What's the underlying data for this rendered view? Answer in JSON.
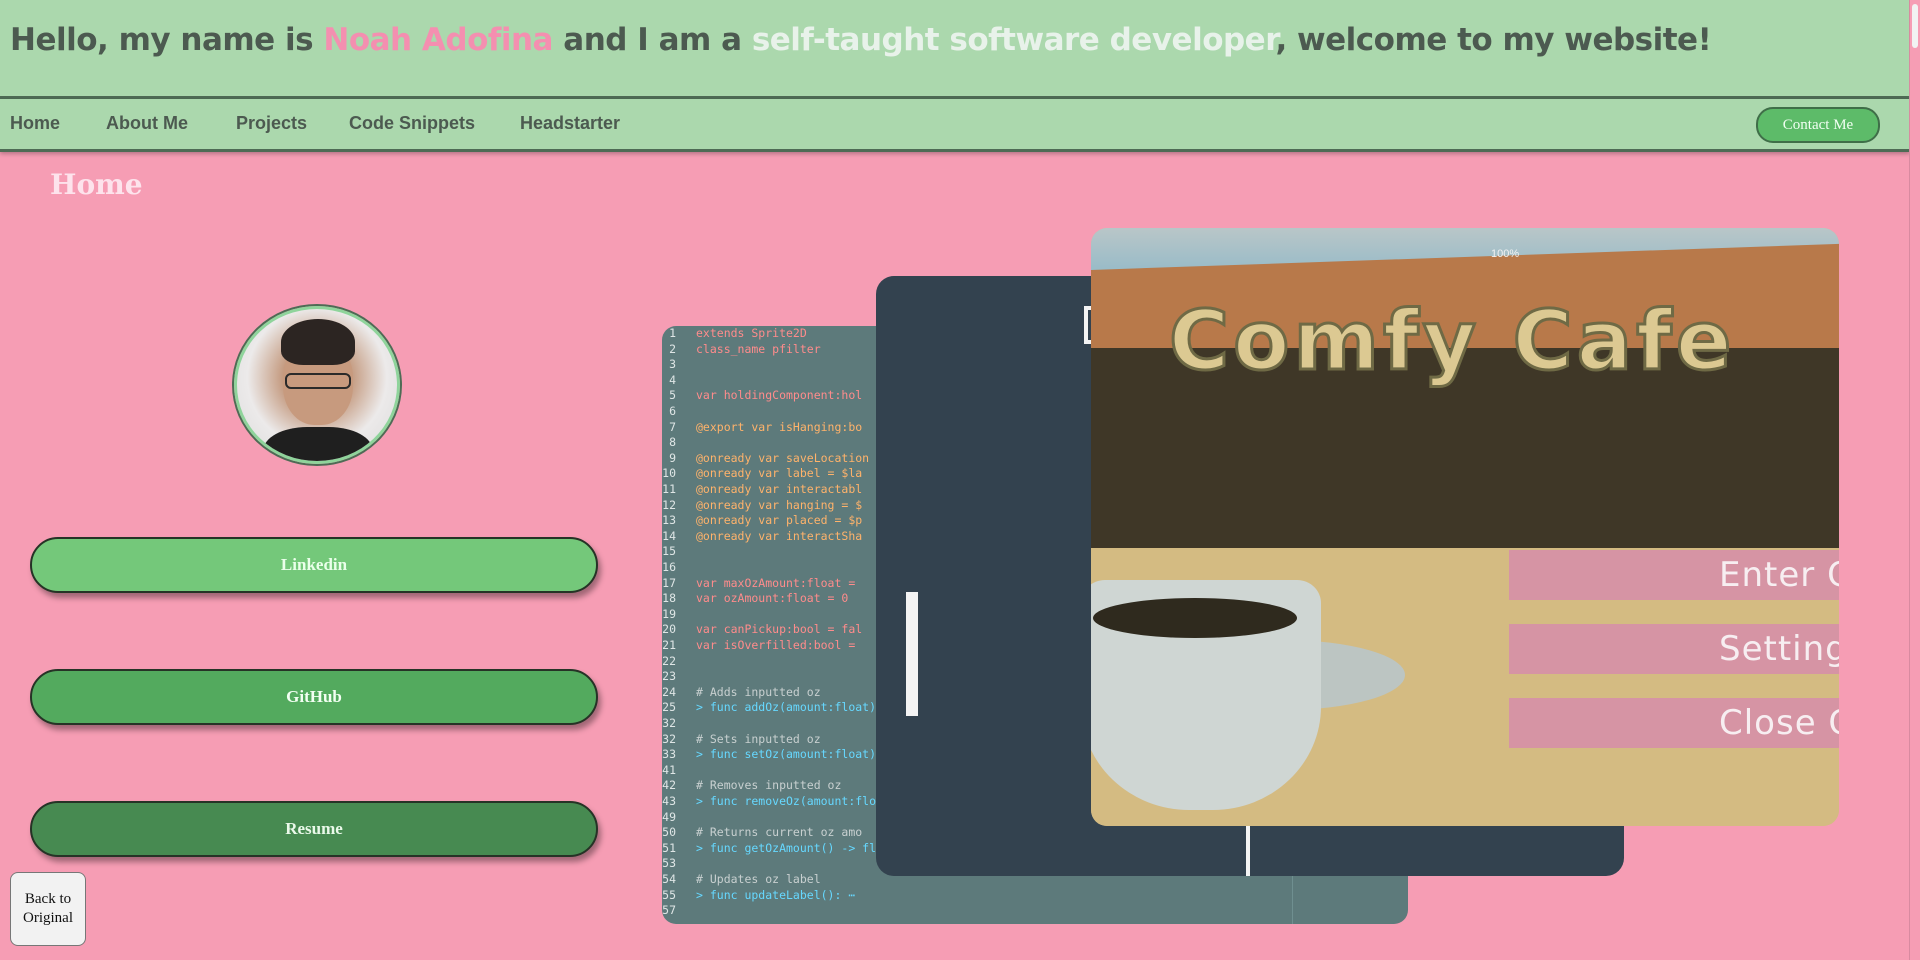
{
  "header": {
    "intro_prefix": "Hello, my name is ",
    "name": "Noah Adofina",
    "intro_middle": " and I am a ",
    "role": "self-taught software developer",
    "intro_suffix": ", welcome to my website!"
  },
  "nav": {
    "items": [
      "Home",
      "About Me",
      "Projects",
      "Code Snippets",
      "Headstarter"
    ],
    "contact_label": "Contact Me"
  },
  "page": {
    "heading": "Home",
    "buttons": [
      "Linkedin",
      "GitHub",
      "Resume"
    ],
    "back_label_line1": "Back to",
    "back_label_line2": "Original"
  },
  "projects": {
    "cafe": {
      "percent": "100%",
      "title": "Comfy Cafe",
      "menu": [
        "Enter Ca",
        "Setting",
        "Close Ga"
      ]
    },
    "code": {
      "lines": [
        {
          "n": "1",
          "t": "extends Sprite2D"
        },
        {
          "n": "2",
          "t": "class_name pfilter"
        },
        {
          "n": "3",
          "t": ""
        },
        {
          "n": "4",
          "t": ""
        },
        {
          "n": "5",
          "t": "var holdingComponent:hol"
        },
        {
          "n": "6",
          "t": ""
        },
        {
          "n": "7",
          "t": "@export var isHanging:bo"
        },
        {
          "n": "8",
          "t": ""
        },
        {
          "n": "9",
          "t": "@onready var saveLocation"
        },
        {
          "n": "10",
          "t": "@onready var label = $la"
        },
        {
          "n": "11",
          "t": "@onready var interactabl"
        },
        {
          "n": "12",
          "t": "@onready var hanging = $"
        },
        {
          "n": "13",
          "t": "@onready var placed = $p"
        },
        {
          "n": "14",
          "t": "@onready var interactSha"
        },
        {
          "n": "15",
          "t": ""
        },
        {
          "n": "16",
          "t": ""
        },
        {
          "n": "17",
          "t": "var maxOzAmount:float ="
        },
        {
          "n": "18",
          "t": "var ozAmount:float = 0"
        },
        {
          "n": "19",
          "t": ""
        },
        {
          "n": "20",
          "t": "var canPickup:bool = fal"
        },
        {
          "n": "21",
          "t": "var isOverfilled:bool ="
        },
        {
          "n": "22",
          "t": ""
        },
        {
          "n": "23",
          "t": ""
        },
        {
          "n": "24",
          "t": "# Adds inputted oz"
        },
        {
          "n": "25",
          "t": "> func addOz(amount:float)"
        },
        {
          "n": "32",
          "t": ""
        },
        {
          "n": "32",
          "t": "# Sets inputted oz"
        },
        {
          "n": "33",
          "t": "> func setOz(amount:float)"
        },
        {
          "n": "41",
          "t": ""
        },
        {
          "n": "42",
          "t": "# Removes inputted oz"
        },
        {
          "n": "43",
          "t": "> func removeOz(amount:flo"
        },
        {
          "n": "49",
          "t": ""
        },
        {
          "n": "50",
          "t": "# Returns current oz amo"
        },
        {
          "n": "51",
          "t": "> func getOzAmount() -> fl"
        },
        {
          "n": "53",
          "t": ""
        },
        {
          "n": "54",
          "t": "# Updates oz label"
        },
        {
          "n": "55",
          "t": "> func updateLabel(): ⋯"
        },
        {
          "n": "57",
          "t": ""
        }
      ]
    }
  },
  "colors": {
    "background": "#f69db4",
    "header": "#abd8ad",
    "name_accent": "#f48fb0",
    "button_linkedin": "#74c87a",
    "button_github": "#53aa5e",
    "button_resume": "#478a51"
  }
}
